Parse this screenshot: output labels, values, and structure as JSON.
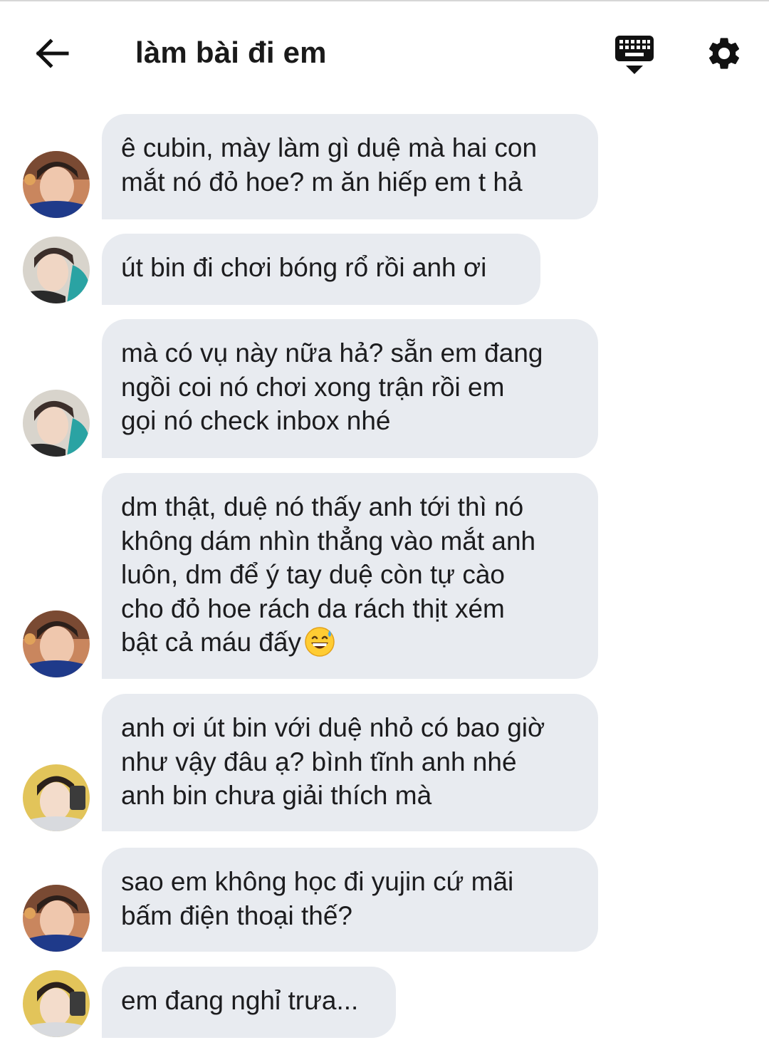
{
  "header": {
    "title": "làm bài đi em",
    "back_icon": "arrow-left-icon",
    "keyboard_icon": "keyboard-hide-icon",
    "settings_icon": "gear-icon"
  },
  "colors": {
    "bubble": "#e8ebf0",
    "text": "#1c1c1e",
    "background": "#ffffff"
  },
  "messages": [
    {
      "avatar": "avatar-a",
      "lines": [
        "ê cubin, mày làm gì duệ mà hai con",
        "mắt nó đỏ hoe? m ăn hiếp em t hả"
      ]
    },
    {
      "avatar": "avatar-b",
      "lines": [
        "út bin đi chơi bóng rổ rồi anh ơi"
      ]
    },
    {
      "avatar": "avatar-b",
      "lines": [
        "mà có vụ này nữa hả? sẵn em đang",
        "ngồi coi nó chơi xong trận rồi em",
        "gọi nó check inbox nhé"
      ]
    },
    {
      "avatar": "avatar-a",
      "lines": [
        "dm thật, duệ nó thấy anh tới thì nó",
        "không dám nhìn thẳng vào mắt anh",
        "luôn, dm để ý tay duệ còn tự cào",
        "cho đỏ hoe rách da rách thịt xém",
        "bật cả máu đấy"
      ],
      "emoji": "grinning-sweat-emoji"
    },
    {
      "avatar": "avatar-c",
      "lines": [
        "anh ơi út bin với duệ nhỏ có bao giờ",
        "như vậy đâu ạ? bình tĩnh anh nhé",
        "anh bin chưa giải thích mà"
      ]
    },
    {
      "avatar": "avatar-a",
      "lines": [
        "sao em không học đi yujin cứ mãi",
        "bấm điện thoại thế?"
      ]
    },
    {
      "avatar": "avatar-c",
      "lines": [
        "em đang nghỉ trưa..."
      ]
    }
  ]
}
